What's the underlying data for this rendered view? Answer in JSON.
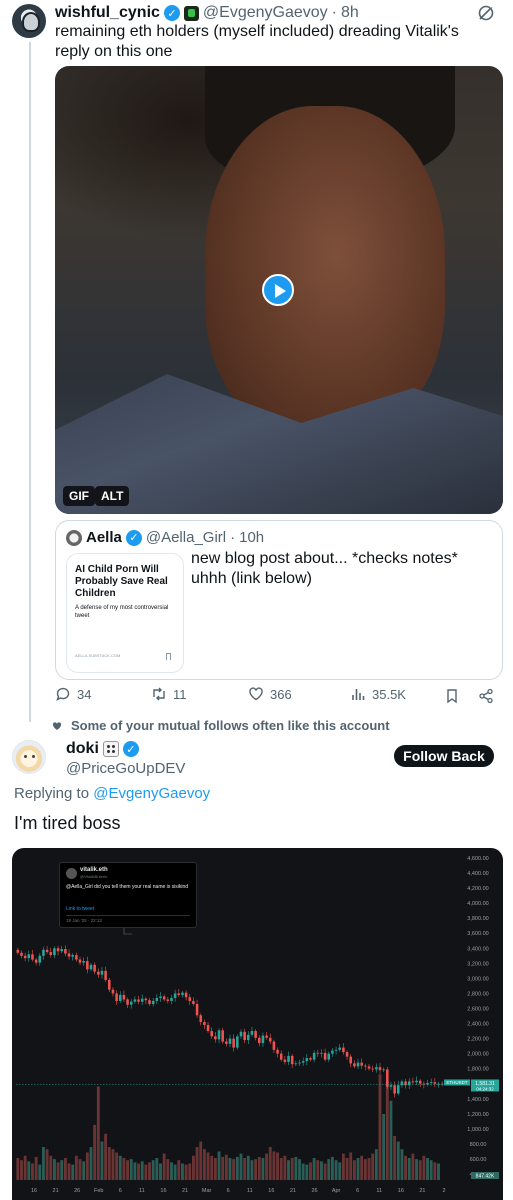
{
  "tweet1": {
    "author_name": "wishful_cynic",
    "author_handle": "@EvgenyGaevoy",
    "time": "8h",
    "text": "remaining eth holders (myself included) dreading Vitalik's reply on this one",
    "media": {
      "badge_gif": "GIF",
      "badge_alt": "ALT"
    },
    "quote": {
      "author_name": "Aella",
      "author_handle": "@Aella_Girl",
      "time": "10h",
      "text": "new blog post about... *checks notes* uhhh (link below)",
      "card": {
        "title": "AI Child Porn Will Probably Save Real Children",
        "subtitle": "A defense of my most controversial tweet",
        "domain": "AELLA.SUBSTACK.COM"
      }
    },
    "stats": {
      "replies": "34",
      "reposts": "11",
      "likes": "366",
      "views": "35.5K"
    }
  },
  "tweet2": {
    "social_context": "Some of your mutual follows often like this account",
    "author_name": "doki",
    "author_handle": "@PriceGoUpDEV",
    "follow_label": "Follow Back",
    "replying_prefix": "Replying to",
    "replying_handle": "@EvgenyGaevoy",
    "text": "I'm tired boss",
    "embedded_tweet": {
      "name": "vitalik.eth",
      "handle": "@VitalikButerin",
      "text": "@Aella_Girl did you tell them your real name is sisikind",
      "link": "Link to tweet",
      "date": "19 Jan '25 · 22:13"
    }
  },
  "chart_data": {
    "type": "candlestick",
    "title": "",
    "y_ticks": [
      "4,600.00",
      "4,400.00",
      "4,200.00",
      "4,000.00",
      "3,800.00",
      "3,600.00",
      "3,400.00",
      "3,200.00",
      "3,000.00",
      "2,800.00",
      "2,600.00",
      "2,400.00",
      "2,200.00",
      "2,000.00",
      "1,800.00",
      "1,600.00",
      "1,400.00",
      "1,200.00",
      "1,000.00",
      "800.00",
      "600.00",
      "400.00"
    ],
    "x_ticks": [
      "16",
      "21",
      "26",
      "Feb",
      "6",
      "11",
      "16",
      "21",
      "Mar",
      "6",
      "11",
      "16",
      "21",
      "26",
      "Apr",
      "6",
      "11",
      "16",
      "21",
      "2"
    ],
    "ylim": [
      400,
      4600
    ],
    "price_label": {
      "symbol": "ETHUSDT",
      "value": "1,581.31",
      "countdown": "04:24:32"
    },
    "volume_labels": [
      "847.42K"
    ],
    "closes": [
      3340,
      3300,
      3270,
      3320,
      3250,
      3210,
      3300,
      3380,
      3350,
      3310,
      3400,
      3360,
      3390,
      3330,
      3290,
      3310,
      3250,
      3210,
      3230,
      3120,
      3180,
      3090,
      3050,
      3100,
      2980,
      2850,
      2800,
      2700,
      2780,
      2720,
      2650,
      2690,
      2720,
      2690,
      2730,
      2710,
      2660,
      2700,
      2740,
      2760,
      2720,
      2700,
      2740,
      2800,
      2780,
      2810,
      2750,
      2700,
      2660,
      2510,
      2420,
      2380,
      2300,
      2230,
      2190,
      2310,
      2160,
      2130,
      2200,
      2080,
      2230,
      2290,
      2180,
      2250,
      2300,
      2210,
      2140,
      2240,
      2210,
      2160,
      2050,
      2000,
      1920,
      1890,
      1970,
      1860,
      1870,
      1880,
      1900,
      1940,
      1920,
      2010,
      2000,
      2010,
      1920,
      2000,
      2040,
      2050,
      2080,
      2020,
      1960,
      1870,
      1830,
      1880,
      1840,
      1830,
      1800,
      1790,
      1820,
      1780,
      1790,
      1560,
      1580,
      1470,
      1580,
      1630,
      1580,
      1630,
      1620,
      1640,
      1600,
      1590,
      1610,
      1620,
      1600,
      1600,
      1590
    ],
    "volumes": [
      0.2,
      0.18,
      0.22,
      0.17,
      0.15,
      0.21,
      0.14,
      0.3,
      0.28,
      0.22,
      0.19,
      0.16,
      0.18,
      0.2,
      0.15,
      0.14,
      0.22,
      0.19,
      0.17,
      0.25,
      0.3,
      0.5,
      0.85,
      0.35,
      0.42,
      0.3,
      0.28,
      0.25,
      0.22,
      0.2,
      0.18,
      0.19,
      0.16,
      0.15,
      0.17,
      0.14,
      0.16,
      0.18,
      0.2,
      0.15,
      0.24,
      0.19,
      0.16,
      0.14,
      0.18,
      0.15,
      0.14,
      0.15,
      0.22,
      0.3,
      0.35,
      0.28,
      0.25,
      0.22,
      0.2,
      0.26,
      0.21,
      0.23,
      0.2,
      0.19,
      0.21,
      0.24,
      0.2,
      0.22,
      0.18,
      0.19,
      0.21,
      0.2,
      0.24,
      0.3,
      0.26,
      0.25,
      0.2,
      0.22,
      0.18,
      0.2,
      0.21,
      0.19,
      0.15,
      0.14,
      0.16,
      0.2,
      0.18,
      0.17,
      0.15,
      0.19,
      0.21,
      0.18,
      0.16,
      0.24,
      0.2,
      0.25,
      0.18,
      0.2,
      0.22,
      0.19,
      0.2,
      0.24,
      0.28,
      0.96,
      0.6,
      0.9,
      0.72,
      0.4,
      0.35,
      0.28,
      0.22,
      0.2,
      0.24,
      0.19,
      0.18,
      0.22,
      0.2,
      0.18,
      0.16,
      0.15
    ]
  }
}
